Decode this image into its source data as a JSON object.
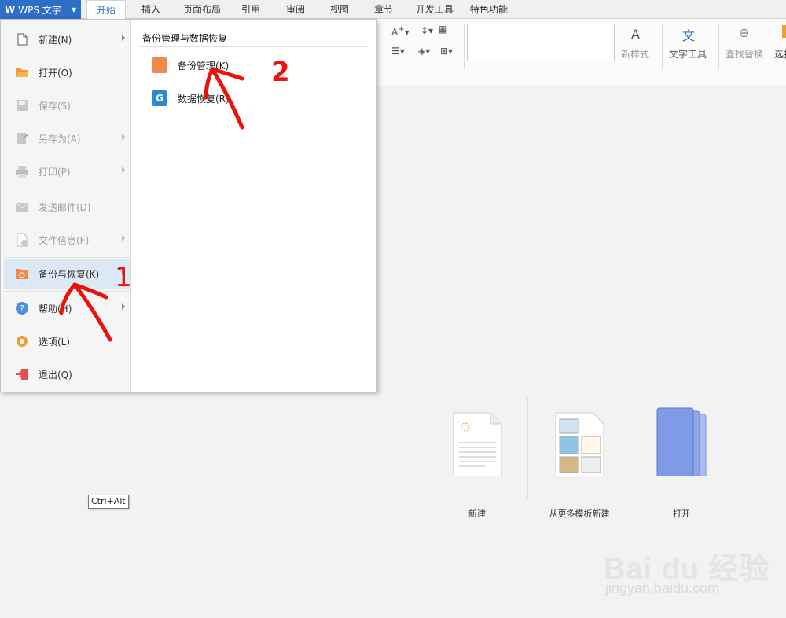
{
  "app": {
    "title": "WPS 文字"
  },
  "tabs": [
    "开始",
    "插入",
    "页面布局",
    "引用",
    "审阅",
    "视图",
    "章节",
    "开发工具",
    "特色功能"
  ],
  "ribbon": {
    "style_label": "新样式",
    "text_tools": "文字工具",
    "find_replace": "查找替换",
    "select": "选择"
  },
  "file_menu": {
    "items": [
      {
        "label": "新建(N)",
        "icon": "new-document-icon",
        "disabled": false,
        "submenu": true
      },
      {
        "label": "打开(O)",
        "icon": "open-folder-icon",
        "disabled": false,
        "submenu": false
      },
      {
        "label": "保存(S)",
        "icon": "save-icon",
        "disabled": true,
        "submenu": false
      },
      {
        "label": "另存为(A)",
        "icon": "save-as-icon",
        "disabled": true,
        "submenu": true
      },
      {
        "label": "打印(P)",
        "icon": "print-icon",
        "disabled": true,
        "submenu": true
      },
      {
        "label": "发送邮件(D)",
        "icon": "mail-icon",
        "disabled": true,
        "submenu": false
      },
      {
        "label": "文件信息(F)",
        "icon": "file-info-icon",
        "disabled": true,
        "submenu": true
      },
      {
        "label": "备份与恢复(K)",
        "icon": "backup-icon",
        "disabled": false,
        "submenu": true,
        "selected": true
      },
      {
        "label": "帮助(H)",
        "icon": "help-icon",
        "disabled": false,
        "submenu": true
      },
      {
        "label": "选项(L)",
        "icon": "options-gear-icon",
        "disabled": false,
        "submenu": false
      },
      {
        "label": "退出(Q)",
        "icon": "exit-icon",
        "disabled": false,
        "submenu": false
      }
    ]
  },
  "submenu": {
    "title": "备份管理与数据恢复",
    "items": [
      {
        "label": "备份管理(K)",
        "icon": "backup-manage-icon"
      },
      {
        "label": "数据恢复(R)",
        "icon": "data-recovery-icon"
      }
    ]
  },
  "start_page": {
    "new": "新建",
    "from_template": "从更多模板新建",
    "open": "打开"
  },
  "tooltip": "Ctrl+Alt",
  "watermark": {
    "brand": "Bai du 经验",
    "url": "jingyan.baidu.com"
  },
  "annotations": {
    "one": "1",
    "two": "2"
  },
  "colors": {
    "accent": "#2c6fc4",
    "annotation": "#e8130c"
  }
}
